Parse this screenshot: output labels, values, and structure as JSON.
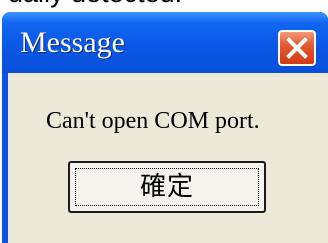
{
  "background": {
    "partial_text": "ually detected."
  },
  "dialog": {
    "title": "Message",
    "message": "Can't open COM port.",
    "ok_label": "確定",
    "colors": {
      "titlebar": "#0a58e6",
      "body": "#ece9d8",
      "close_button": "#e04a22"
    }
  },
  "icons": {
    "close": "close-icon"
  }
}
